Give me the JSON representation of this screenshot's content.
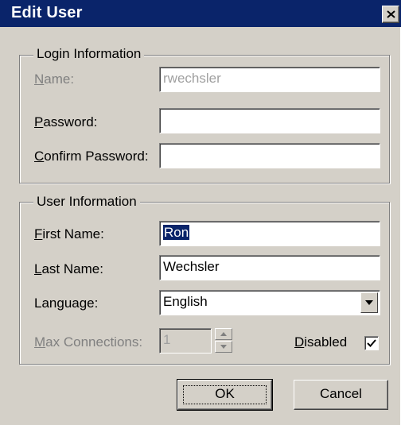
{
  "window": {
    "title": "Edit User",
    "close_glyph": "×"
  },
  "login_group": {
    "label": "Login Information",
    "name_label_u": "N",
    "name_label_rest": "ame:",
    "name_value": "rwechsler",
    "password_label_u": "P",
    "password_label_rest": "assword:",
    "password_value": "",
    "confirm_label_u": "C",
    "confirm_label_rest": "onfirm Password:",
    "confirm_value": ""
  },
  "user_group": {
    "label": "User Information",
    "first_name_label_u": "F",
    "first_name_label_rest": "irst Name:",
    "first_name_value": "Ron",
    "last_name_label_u": "L",
    "last_name_label_rest": "ast Name:",
    "last_name_value": "Wechsler",
    "language_label": "Language:",
    "language_value": "English",
    "max_conn_label_u": "M",
    "max_conn_label_rest": "ax Connections:",
    "max_conn_value": "1",
    "disabled_label_u": "D",
    "disabled_label_rest": "isabled",
    "disabled_checked": true
  },
  "buttons": {
    "ok": "OK",
    "cancel": "Cancel"
  },
  "icons": {
    "close": "close-icon",
    "dropdown": "chevron-down-icon",
    "spin_up": "arrow-up-icon",
    "spin_down": "arrow-down-icon",
    "check": "check-icon"
  },
  "colors": {
    "titlebar": "#0a246a",
    "face": "#d4d0c8",
    "selection": "#0a246a"
  }
}
